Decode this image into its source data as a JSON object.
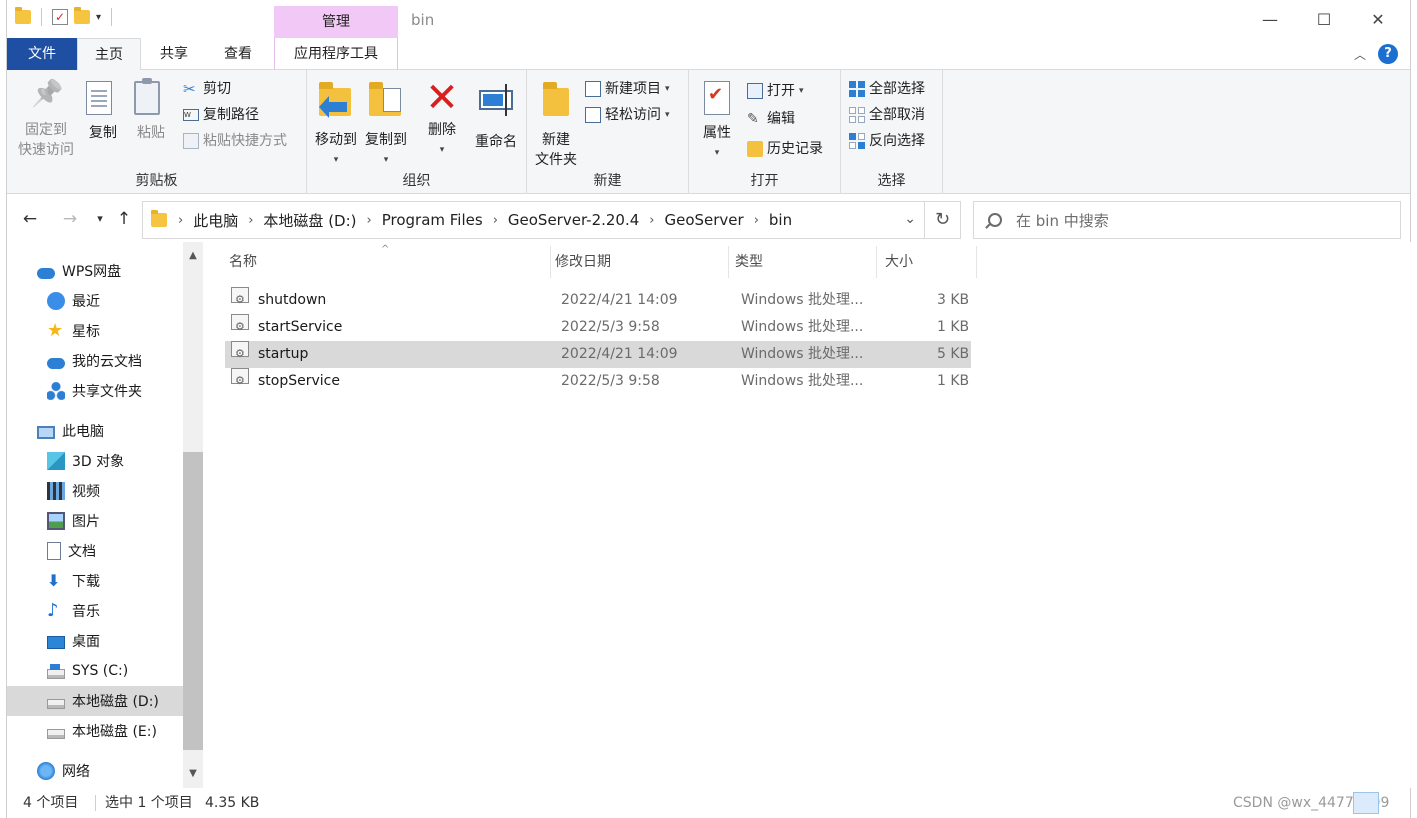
{
  "window": {
    "title": "bin",
    "manage_tab": "管理"
  },
  "tabs": {
    "file": "文件",
    "home": "主页",
    "share": "共享",
    "view": "查看",
    "app_tools": "应用程序工具"
  },
  "ribbon": {
    "clipboard": {
      "label": "剪贴板",
      "pin_line1": "固定到",
      "pin_line2": "快速访问",
      "copy": "复制",
      "paste": "粘贴",
      "cut": "剪切",
      "copy_path": "复制路径",
      "paste_shortcut": "粘贴快捷方式"
    },
    "organize": {
      "label": "组织",
      "move_to": "移动到",
      "copy_to": "复制到",
      "delete": "删除",
      "rename": "重命名"
    },
    "new": {
      "label": "新建",
      "new_folder_line1": "新建",
      "new_folder_line2": "文件夹",
      "new_item": "新建项目",
      "easy_access": "轻松访问"
    },
    "open": {
      "label": "打开",
      "properties": "属性",
      "open": "打开",
      "edit": "编辑",
      "history": "历史记录"
    },
    "select": {
      "label": "选择",
      "select_all": "全部选择",
      "select_none": "全部取消",
      "invert": "反向选择"
    }
  },
  "address": {
    "crumbs": [
      "此电脑",
      "本地磁盘 (D:)",
      "Program Files",
      "GeoServer-2.20.4",
      "GeoServer",
      "bin"
    ],
    "search_placeholder": "在 bin 中搜索"
  },
  "sidebar": {
    "items": [
      {
        "label": "WPS网盘"
      },
      {
        "label": "最近"
      },
      {
        "label": "星标"
      },
      {
        "label": "我的云文档"
      },
      {
        "label": "共享文件夹"
      },
      {
        "label": "此电脑"
      },
      {
        "label": "3D 对象"
      },
      {
        "label": "视频"
      },
      {
        "label": "图片"
      },
      {
        "label": "文档"
      },
      {
        "label": "下载"
      },
      {
        "label": "音乐"
      },
      {
        "label": "桌面"
      },
      {
        "label": "SYS (C:)"
      },
      {
        "label": "本地磁盘 (D:)"
      },
      {
        "label": "本地磁盘 (E:)"
      },
      {
        "label": "网络"
      }
    ]
  },
  "filelist": {
    "columns": [
      "名称",
      "修改日期",
      "类型",
      "大小"
    ],
    "rows": [
      {
        "name": "shutdown",
        "date": "2022/4/21 14:09",
        "type": "Windows 批处理...",
        "size": "3 KB"
      },
      {
        "name": "startService",
        "date": "2022/5/3 9:58",
        "type": "Windows 批处理...",
        "size": "1 KB"
      },
      {
        "name": "startup",
        "date": "2022/4/21 14:09",
        "type": "Windows 批处理...",
        "size": "5 KB"
      },
      {
        "name": "stopService",
        "date": "2022/5/3 9:58",
        "type": "Windows 批处理...",
        "size": "1 KB"
      }
    ]
  },
  "status": {
    "count": "4 个项目",
    "selection": "选中 1 个项目",
    "size": "4.35 KB"
  },
  "watermark": "CSDN @wx_44778309"
}
